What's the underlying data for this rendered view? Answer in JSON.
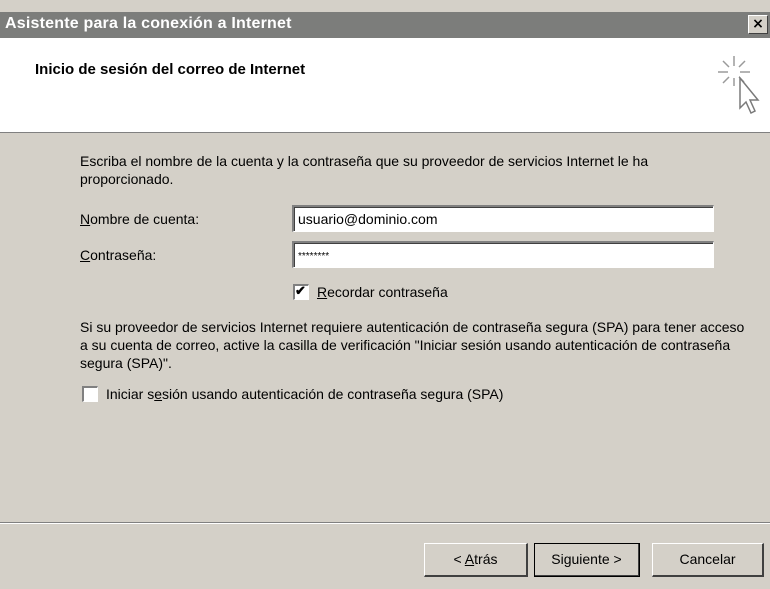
{
  "window": {
    "title": "Asistente para la conexión a Internet",
    "close_glyph": "×"
  },
  "header": {
    "heading": "Inicio de sesión del correo de Internet",
    "icon": "wizard-cursor-sparkle-icon"
  },
  "intro": {
    "text": "Escriba el nombre de la cuenta y la contraseña que su proveedor de servicios Internet le ha proporcionado."
  },
  "account": {
    "label_accel": "N",
    "label_rest": "ombre de cuenta:",
    "value": "usuario@dominio.com"
  },
  "password": {
    "label_accel": "C",
    "label_rest": "ontraseña:",
    "value": "********"
  },
  "remember": {
    "checked": true,
    "label_accel": "R",
    "label_rest": "ecordar contraseña"
  },
  "spa": {
    "description": "Si su proveedor de servicios Internet requiere autenticación de contraseña segura (SPA) para tener acceso a su cuenta de correo, active la casilla de verificación \"Iniciar sesión usando autenticación de contraseña segura (SPA)\".",
    "checked": false,
    "label_pre": "Iniciar s",
    "label_accel": "e",
    "label_post": "sión usando autenticación de contraseña segura (SPA)"
  },
  "buttons": {
    "back_pre": "< ",
    "back_accel": "A",
    "back_post": "trás",
    "next": "Siguiente >",
    "cancel": "Cancelar"
  },
  "colors": {
    "titlebar": "#7c7d7b",
    "face": "#d4d0c8",
    "header_bg": "#ffffff"
  }
}
